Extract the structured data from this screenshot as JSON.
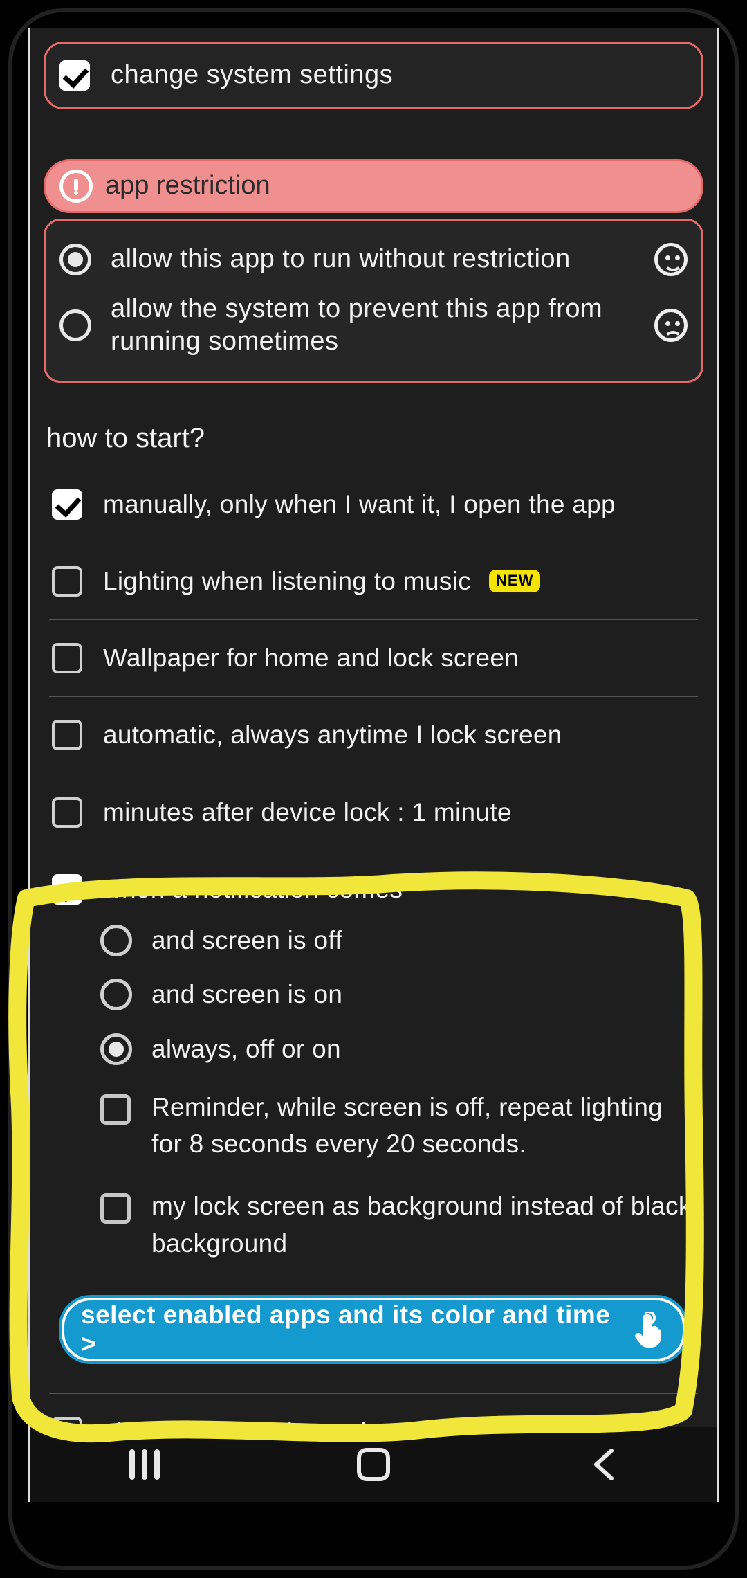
{
  "permissions": {
    "change_system_settings": "change system settings"
  },
  "restriction": {
    "header": "app restriction",
    "allow_no_restriction": "allow this app to run without restriction",
    "allow_prevent": "allow the system to prevent this app from running sometimes"
  },
  "how_to_start": {
    "title": "how to start?",
    "manually": "manually, only when I want it, I open the app",
    "music": "Lighting when listening to music",
    "new_badge": "NEW",
    "wallpaper": "Wallpaper for home and lock screen",
    "automatic": "automatic, always anytime I lock screen",
    "minutes_after": "minutes after device lock : 1 minute",
    "notification": "when a notification comes",
    "notif_off": "and screen is off",
    "notif_on": "and screen is on",
    "notif_always": "always, off or on",
    "reminder": "Reminder, while screen is off, repeat lighting for 8 seconds every 20 seconds.",
    "lockscreen_bg": "my lock screen as background instead of black background",
    "select_apps_btn": "select enabled apps and its color and time >",
    "clock_always": "clock always, edges when a notification comes"
  }
}
